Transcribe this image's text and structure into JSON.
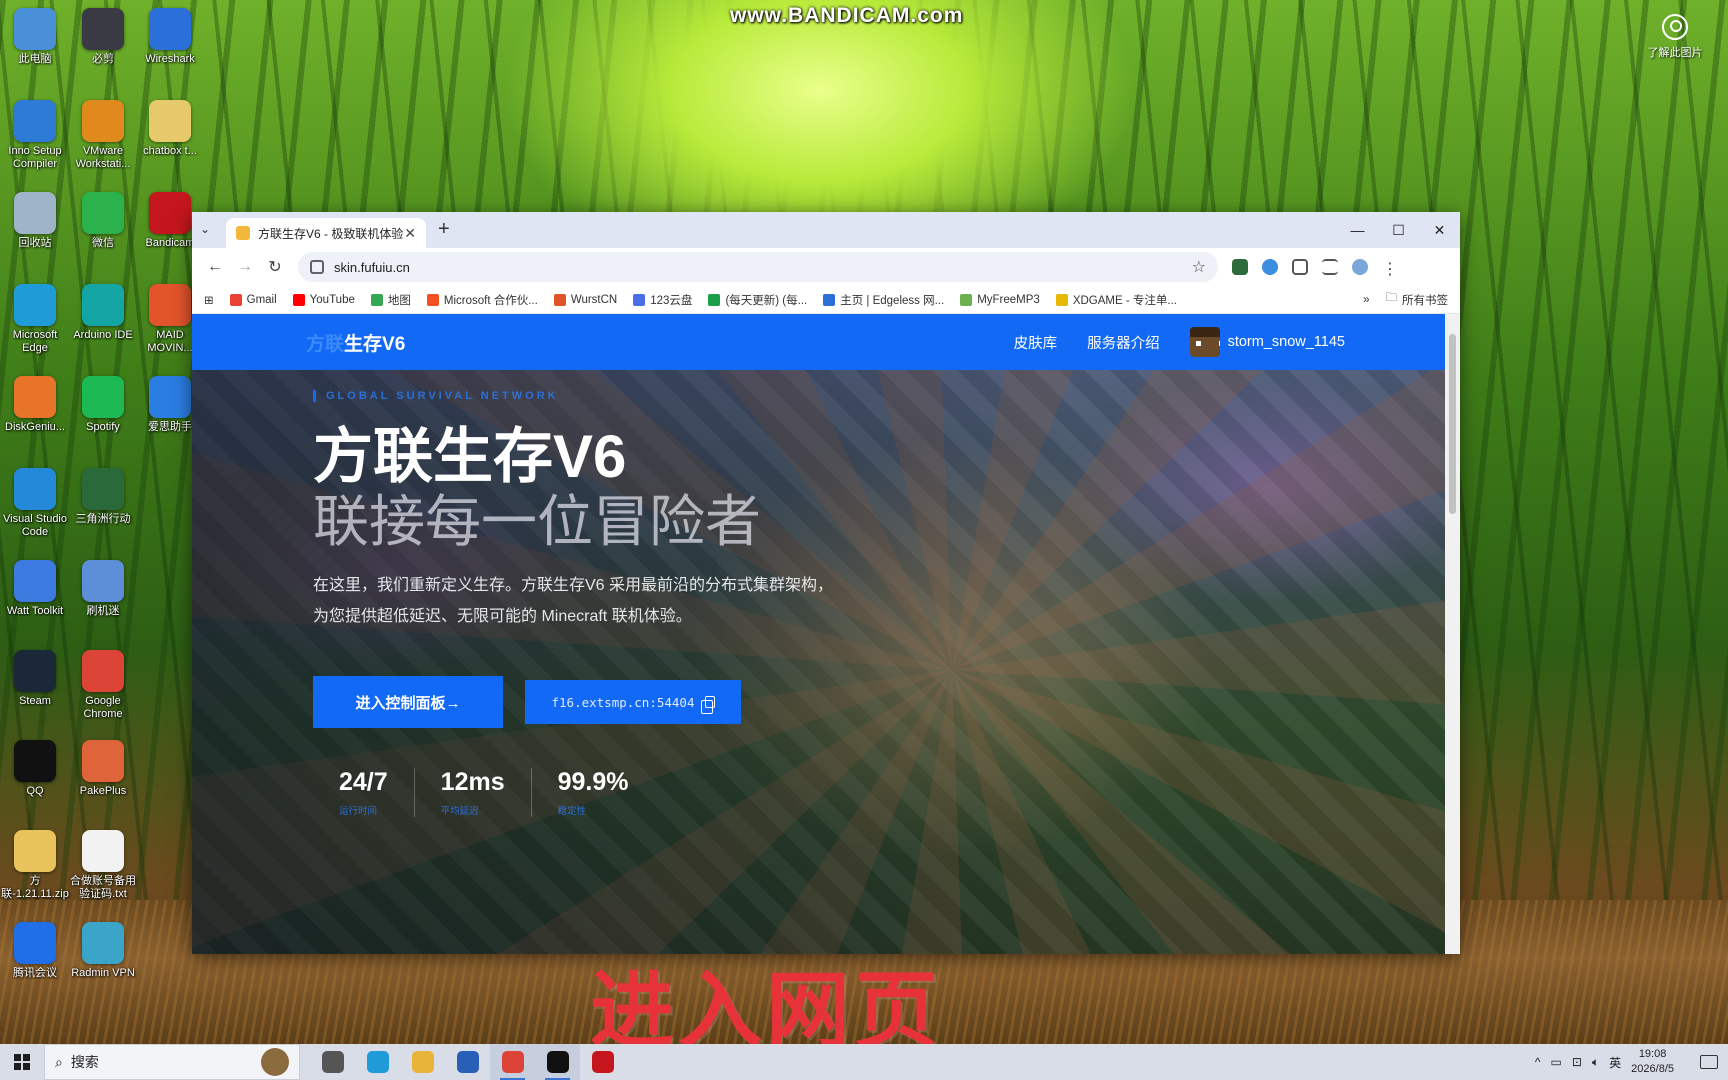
{
  "watermark": "www.BANDICAM.com",
  "learn_label": "了解此图片",
  "desktop_icons": [
    {
      "label": "此电脑",
      "color": "#4a90d9"
    },
    {
      "label": "必剪",
      "color": "#3a3a44"
    },
    {
      "label": "Wireshark",
      "color": "#2b6fd9"
    },
    {
      "label": "Inno Setup Compiler",
      "color": "#2e7bd6"
    },
    {
      "label": "VMware Workstati...",
      "color": "#e08a1e"
    },
    {
      "label": "chatbox t...",
      "color": "#e6c96a"
    },
    {
      "label": "回收站",
      "color": "#9fb4c8"
    },
    {
      "label": "微信",
      "color": "#2bb24c"
    },
    {
      "label": "Bandicam",
      "color": "#c4161c"
    },
    {
      "label": "Microsoft Edge",
      "color": "#1f9bd8"
    },
    {
      "label": "Arduino IDE",
      "color": "#16a5a5"
    },
    {
      "label": "MAID MOVIN...",
      "color": "#e2542a"
    },
    {
      "label": "DiskGeniu...",
      "color": "#e8742a"
    },
    {
      "label": "Spotify",
      "color": "#1db954"
    },
    {
      "label": "爱思助手",
      "color": "#2a7de1"
    },
    {
      "label": "Visual Studio Code",
      "color": "#2389d8"
    },
    {
      "label": "三角洲行动",
      "color": "#2a6a3a"
    },
    {
      "label": "Watt Toolkit",
      "color": "#3d7be0"
    },
    {
      "label": "刷机迷",
      "color": "#5c8fd8"
    },
    {
      "label": "Steam",
      "color": "#1b2838"
    },
    {
      "label": "Google Chrome",
      "color": "#db4437"
    },
    {
      "label": "QQ",
      "color": "#111111"
    },
    {
      "label": "PakePlus",
      "color": "#e0643a"
    },
    {
      "label": "方联-1.21.11.zip",
      "color": "#e8c25a"
    },
    {
      "label": "合做账号备用验证码.txt",
      "color": "#f2f2f2"
    },
    {
      "label": "腾讯会议",
      "color": "#1f6fe8"
    },
    {
      "label": "Radmin VPN",
      "color": "#3aa5c8"
    }
  ],
  "browser": {
    "tab_title": "方联生存V6 - 极致联机体验",
    "tab_close": "✕",
    "new_tab": "+",
    "url": "skin.fufuiu.cn",
    "window_controls": [
      "—",
      "☐",
      "✕"
    ],
    "bookmarks": [
      {
        "label": "Gmail",
        "color": "#ea4335"
      },
      {
        "label": "YouTube",
        "color": "#ff0000"
      },
      {
        "label": "地图",
        "color": "#34a853"
      },
      {
        "label": "Microsoft 合作伙...",
        "color": "#f25022"
      },
      {
        "label": "WurstCN",
        "color": "#e2542a"
      },
      {
        "label": "123云盘",
        "color": "#4b6ee8"
      },
      {
        "label": "(每天更新) (每...",
        "color": "#1a9e4a"
      },
      {
        "label": "主页 | Edgeless 网...",
        "color": "#2a6fd8"
      },
      {
        "label": "MyFreeMP3",
        "color": "#6ab04c"
      },
      {
        "label": "XDGAME - 专注单...",
        "color": "#e6b800"
      }
    ],
    "bookmarks_more": "»",
    "all_bookmarks": "所有书签"
  },
  "site": {
    "logo_prefix": "方联",
    "logo_main": "生存V6",
    "nav": [
      "皮肤库",
      "服务器介绍"
    ],
    "username": "storm_snow_1145",
    "kicker": "GLOBAL SURVIVAL NETWORK",
    "title": "方联生存V6",
    "subtitle": "联接每一位冒险者",
    "desc_line1": "在这里，我们重新定义生存。方联生存V6 采用最前沿的分布式集群架构，",
    "desc_line2": "为您提供超低延迟、无限可能的 Minecraft 联机体验。",
    "cta_label": "进入控制面板→",
    "server_address": "f16.extsmp.cn:54404",
    "stats": [
      {
        "value": "24/7",
        "label": "运行时间"
      },
      {
        "value": "12ms",
        "label": "平均延迟"
      },
      {
        "value": "99.9%",
        "label": "稳定性"
      }
    ]
  },
  "caption": "进入网页",
  "taskbar": {
    "search_placeholder": "搜索",
    "apps": [
      {
        "name": "task-view",
        "color": "#555555",
        "active": false
      },
      {
        "name": "edge",
        "color": "#1f9bd8",
        "active": false
      },
      {
        "name": "file-explorer",
        "color": "#e8b43a",
        "active": false
      },
      {
        "name": "pcl",
        "color": "#2a5fb8",
        "active": false
      },
      {
        "name": "chrome",
        "color": "#db4437",
        "active": true
      },
      {
        "name": "qq",
        "color": "#111111",
        "active": true
      },
      {
        "name": "bandicam",
        "color": "#c4161c",
        "active": false
      }
    ],
    "ime": "英",
    "time": "19:08",
    "date": "2026/8/5"
  }
}
